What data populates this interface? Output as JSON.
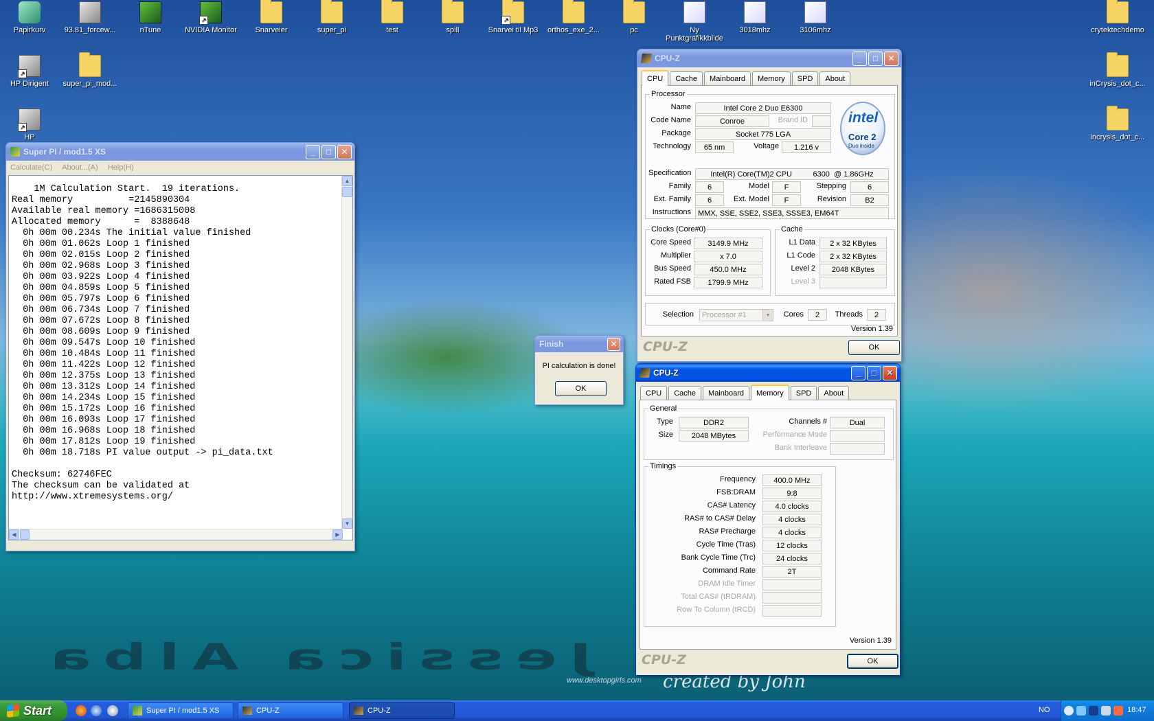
{
  "desktop": {
    "icons": [
      {
        "label": "Papirkurv"
      },
      {
        "label": "93.81_forcew..."
      },
      {
        "label": "nTune"
      },
      {
        "label": "NVIDIA Monitor"
      },
      {
        "label": "Snarveier"
      },
      {
        "label": "super_pi"
      },
      {
        "label": "test"
      },
      {
        "label": "spill"
      },
      {
        "label": "Snarvei til Mp3"
      },
      {
        "label": "orthos_exe_2..."
      },
      {
        "label": "pc"
      },
      {
        "label": "Ny Punktgrafikkbilde"
      },
      {
        "label": "3018mhz"
      },
      {
        "label": "3106mhz"
      },
      {
        "label": "crytektechdemo"
      },
      {
        "label": "HP Dirigent"
      },
      {
        "label": "super_pi_mod..."
      },
      {
        "label": "inCrysis_dot_c..."
      },
      {
        "label": "HP"
      },
      {
        "label": "incrysis_dot_c..."
      }
    ],
    "wallpaper_wordmark": "Jessica Alba",
    "wallpaper_site": "www.desktopgirls.com",
    "wallpaper_credit": "created by John"
  },
  "superpi": {
    "title": "Super PI / mod1.5 XS",
    "menu": [
      "Calculate(C)",
      "About...(A)",
      "Help(H)"
    ],
    "output": "    1M Calculation Start.  19 iterations.\nReal memory          =2145890304\nAvailable real memory =1686315008\nAllocated memory      =  8388648\n  0h 00m 00.234s The initial value finished\n  0h 00m 01.062s Loop 1 finished\n  0h 00m 02.015s Loop 2 finished\n  0h 00m 02.968s Loop 3 finished\n  0h 00m 03.922s Loop 4 finished\n  0h 00m 04.859s Loop 5 finished\n  0h 00m 05.797s Loop 6 finished\n  0h 00m 06.734s Loop 7 finished\n  0h 00m 07.672s Loop 8 finished\n  0h 00m 08.609s Loop 9 finished\n  0h 00m 09.547s Loop 10 finished\n  0h 00m 10.484s Loop 11 finished\n  0h 00m 11.422s Loop 12 finished\n  0h 00m 12.375s Loop 13 finished\n  0h 00m 13.312s Loop 14 finished\n  0h 00m 14.234s Loop 15 finished\n  0h 00m 15.172s Loop 16 finished\n  0h 00m 16.093s Loop 17 finished\n  0h 00m 16.968s Loop 18 finished\n  0h 00m 17.812s Loop 19 finished\n  0h 00m 18.718s PI value output -> pi_data.txt\n\nChecksum: 62746FEC\nThe checksum can be validated at\nhttp://www.xtremesystems.org/"
  },
  "finish_dialog": {
    "title": "Finish",
    "message": "PI calculation is done!",
    "ok": "OK"
  },
  "cpuz_cpu": {
    "title": "CPU-Z",
    "tabs": [
      "CPU",
      "Cache",
      "Mainboard",
      "Memory",
      "SPD",
      "About"
    ],
    "active_tab": "CPU",
    "processor": {
      "group": "Processor",
      "name_label": "Name",
      "name": "Intel Core 2 Duo E6300",
      "codename_label": "Code Name",
      "codename": "Conroe",
      "brandid_label": "Brand ID",
      "brandid": "",
      "package_label": "Package",
      "package": "Socket 775 LGA",
      "technology_label": "Technology",
      "technology": "65 nm",
      "voltage_label": "Voltage",
      "voltage": "1.216 v",
      "spec_label": "Specification",
      "spec": "Intel(R) Core(TM)2 CPU          6300  @ 1.86GHz",
      "family_label": "Family",
      "family": "6",
      "model_label": "Model",
      "model": "F",
      "stepping_label": "Stepping",
      "stepping": "6",
      "extfamily_label": "Ext. Family",
      "extfamily": "6",
      "extmodel_label": "Ext. Model",
      "extmodel": "F",
      "revision_label": "Revision",
      "revision": "B2",
      "instructions_label": "Instructions",
      "instructions": "MMX, SSE, SSE2, SSE3, SSSE3, EM64T",
      "logo_line1": "intel",
      "logo_line2": "Core 2",
      "logo_line3": "Duo   inside"
    },
    "clocks": {
      "group": "Clocks (Core#0)",
      "corespeed_label": "Core Speed",
      "corespeed": "3149.9 MHz",
      "multiplier_label": "Multiplier",
      "multiplier": "x 7.0",
      "busspeed_label": "Bus Speed",
      "busspeed": "450.0 MHz",
      "ratedfsb_label": "Rated FSB",
      "ratedfsb": "1799.9 MHz"
    },
    "cache": {
      "group": "Cache",
      "l1data_label": "L1 Data",
      "l1data": "2 x 32 KBytes",
      "l1code_label": "L1 Code",
      "l1code": "2 x 32 KBytes",
      "level2_label": "Level 2",
      "level2": "2048 KBytes",
      "level3_label": "Level 3",
      "level3": ""
    },
    "selection_label": "Selection",
    "selection": "Processor #1",
    "cores_label": "Cores",
    "cores": "2",
    "threads_label": "Threads",
    "threads": "2",
    "version": "Version 1.39",
    "brand": "CPU-Z",
    "ok": "OK"
  },
  "cpuz_mem": {
    "title": "CPU-Z",
    "tabs": [
      "CPU",
      "Cache",
      "Mainboard",
      "Memory",
      "SPD",
      "About"
    ],
    "active_tab": "Memory",
    "general": {
      "group": "General",
      "type_label": "Type",
      "type": "DDR2",
      "size_label": "Size",
      "size": "2048 MBytes",
      "channels_label": "Channels #",
      "channels": "Dual",
      "perfmode_label": "Performance Mode",
      "perfmode": "",
      "bankinterleave_label": "Bank Interleave",
      "bankinterleave": ""
    },
    "timings": {
      "group": "Timings",
      "rows": [
        {
          "label": "Frequency",
          "value": "400.0 MHz",
          "enabled": true
        },
        {
          "label": "FSB:DRAM",
          "value": "9:8",
          "enabled": true
        },
        {
          "label": "CAS# Latency",
          "value": "4.0 clocks",
          "enabled": true
        },
        {
          "label": "RAS# to CAS# Delay",
          "value": "4 clocks",
          "enabled": true
        },
        {
          "label": "RAS# Precharge",
          "value": "4 clocks",
          "enabled": true
        },
        {
          "label": "Cycle Time (Tras)",
          "value": "12 clocks",
          "enabled": true
        },
        {
          "label": "Bank Cycle Time (Trc)",
          "value": "24 clocks",
          "enabled": true
        },
        {
          "label": "Command Rate",
          "value": "2T",
          "enabled": true
        },
        {
          "label": "DRAM Idle Timer",
          "value": "",
          "enabled": false
        },
        {
          "label": "Total CAS# (tRDRAM)",
          "value": "",
          "enabled": false
        },
        {
          "label": "Row To Column (tRCD)",
          "value": "",
          "enabled": false
        }
      ]
    },
    "version": "Version 1.39",
    "brand": "CPU-Z",
    "ok": "OK"
  },
  "taskbar": {
    "start": "Start",
    "buttons": [
      {
        "label": "Super PI / mod1.5 XS"
      },
      {
        "label": "CPU-Z"
      },
      {
        "label": "CPU-Z"
      }
    ],
    "language": "NO",
    "clock": "18:47"
  }
}
